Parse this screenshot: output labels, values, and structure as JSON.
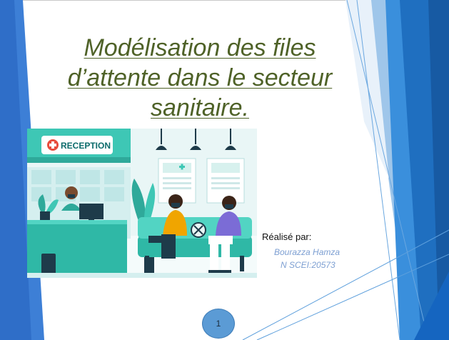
{
  "slide": {
    "title": "Modélisation des files d’attente dans le secteur sanitaire.",
    "realise_label": "Réalisé par:",
    "author": "Bourazza Hamza",
    "scei": "N SCEI:20573",
    "page_number": "1"
  },
  "illustration": {
    "sign_text": "RECEPTION"
  },
  "colors": {
    "title": "#4f6228",
    "author": "#7d9fd2",
    "accent_blue": "#1f6fc0",
    "page_circle": "#5b9bd5",
    "mint": "#3cc3b3"
  }
}
